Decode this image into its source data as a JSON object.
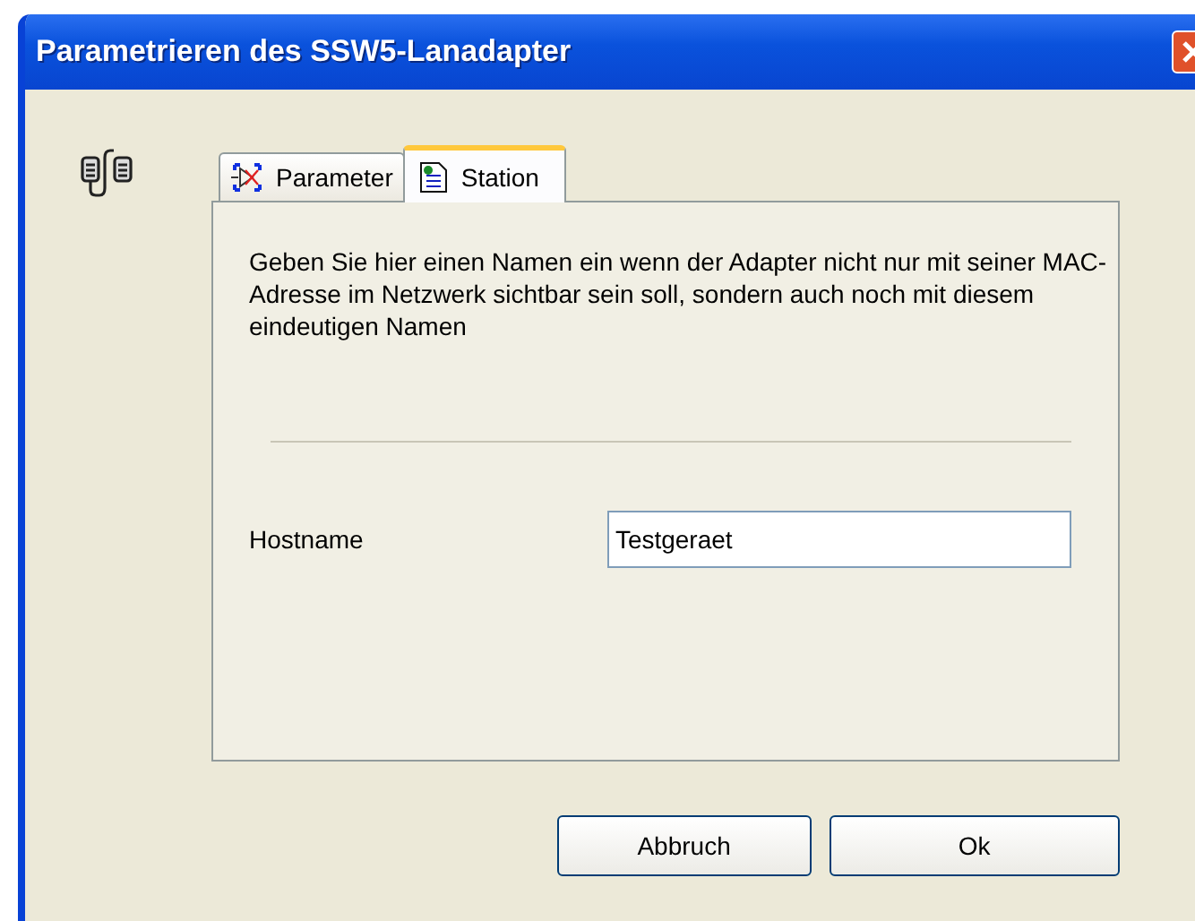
{
  "window": {
    "title": "Parametrieren des SSW5-Lanadapter"
  },
  "tabs": [
    {
      "label": "Parameter",
      "selected": false
    },
    {
      "label": "Station",
      "selected": true
    }
  ],
  "description": "Geben Sie hier einen Namen ein wenn der Adapter nicht nur mit seiner MAC-Adresse im Netzwerk sichtbar sein soll, sondern auch noch mit diesem eindeutigen Namen",
  "hostname": {
    "label": "Hostname",
    "value": "Testgeraet"
  },
  "buttons": [
    "Abbruch",
    "Ok"
  ]
}
